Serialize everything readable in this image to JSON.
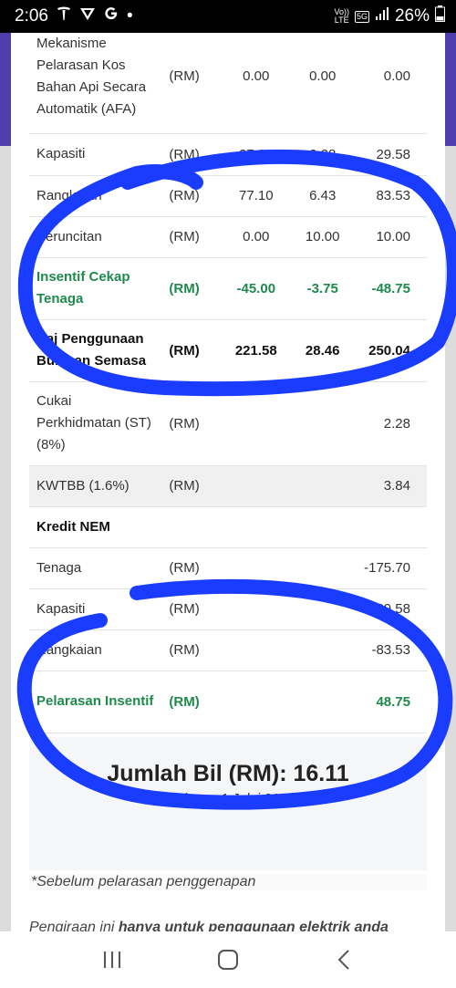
{
  "status": {
    "time": "2:06",
    "app_icons": [
      "tesla-icon",
      "vpn-icon",
      "google-icon"
    ],
    "dot": "•",
    "volte_top": "Vo))",
    "volte_bottom": "LTE",
    "network": "5G",
    "battery": "26%"
  },
  "table": {
    "rows": [
      {
        "desc": "Mekanisme Pelarasan Kos Bahan Api Secara Automatik (AFA)",
        "unit": "(RM)",
        "v1": "0.00",
        "v2": "0.00",
        "v3": "0.00",
        "style": "normal"
      },
      {
        "desc": "Kapasiti",
        "unit": "(RM)",
        "v1": "27.30",
        "v2": "2.28",
        "v3": "29.58",
        "style": "normal"
      },
      {
        "desc": "Rangkaian",
        "unit": "(RM)",
        "v1": "77.10",
        "v2": "6.43",
        "v3": "83.53",
        "style": "normal"
      },
      {
        "desc": "Peruncitan",
        "unit": "(RM)",
        "v1": "0.00",
        "v2": "10.00",
        "v3": "10.00",
        "style": "normal"
      },
      {
        "desc": "Insentif Cekap Tenaga",
        "unit": "(RM)",
        "v1": "-45.00",
        "v2": "-3.75",
        "v3": "-48.75",
        "style": "green"
      },
      {
        "desc": "Caj Penggunaan Bulanan Semasa",
        "unit": "(RM)",
        "v1": "221.58",
        "v2": "28.46",
        "v3": "250.04",
        "style": "bold"
      },
      {
        "desc": "Cukai Perkhidmatan (ST) (8%)",
        "unit": "(RM)",
        "v1": "",
        "v2": "",
        "v3": "2.28",
        "style": "normal"
      },
      {
        "desc": "KWTBB (1.6%)",
        "unit": "(RM)",
        "v1": "",
        "v2": "",
        "v3": "3.84",
        "style": "shade"
      },
      {
        "desc": "Kredit NEM",
        "unit": "",
        "v1": "",
        "v2": "",
        "v3": "",
        "style": "bold"
      },
      {
        "desc": "Tenaga",
        "unit": "(RM)",
        "v1": "",
        "v2": "",
        "v3": "-175.70",
        "style": "normal"
      },
      {
        "desc": "Kapasiti",
        "unit": "(RM)",
        "v1": "",
        "v2": "",
        "v3": "-29.58",
        "style": "normal"
      },
      {
        "desc": "Rangkaian",
        "unit": "(RM)",
        "v1": "",
        "v2": "",
        "v3": "-83.53",
        "style": "normal"
      },
      {
        "desc": "Pelarasan Insentif",
        "unit": "(RM)",
        "v1": "",
        "v2": "",
        "v3": "48.75",
        "style": "green"
      }
    ]
  },
  "summary": {
    "total": "Jumlah Bil (RM): 16.11",
    "note": "*Selepas 1 Julai 2025"
  },
  "notes": {
    "line1": "*Sebelum pelarasan penggenapan",
    "line2_prefix": "Pengiraan ini ",
    "line2_bold": "hanya untuk penggunaan elektrik anda"
  },
  "nav": {
    "recents": "recents-icon",
    "home": "home-icon",
    "back": "back-icon"
  },
  "colors": {
    "header_purple": "#4f3fae",
    "green": "#1e8a4c",
    "annotation_blue": "#1a3cff"
  }
}
